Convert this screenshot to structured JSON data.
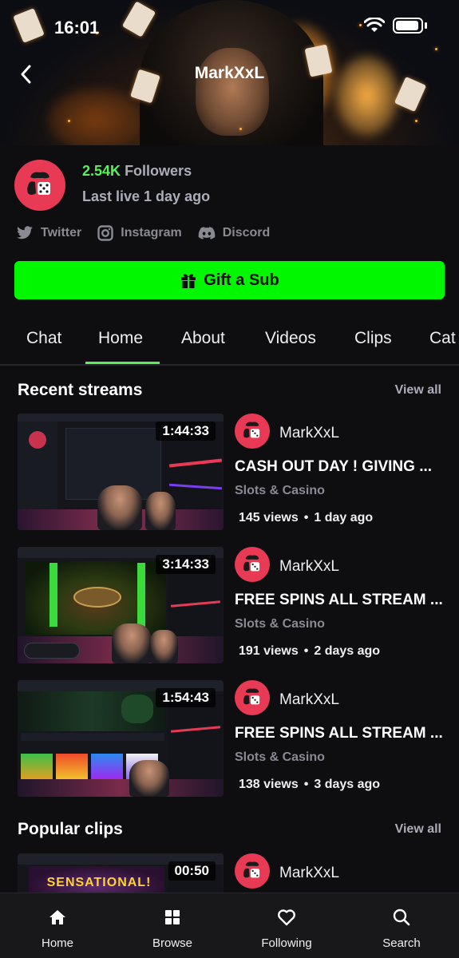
{
  "status_bar": {
    "time": "16:01"
  },
  "header": {
    "channel_name": "MarkXxL"
  },
  "profile": {
    "followers_count": "2.54K",
    "followers_label": "Followers",
    "last_live": "Last live 1 day ago"
  },
  "socials": [
    {
      "label": "Twitter",
      "icon": "twitter-icon"
    },
    {
      "label": "Instagram",
      "icon": "instagram-icon"
    },
    {
      "label": "Discord",
      "icon": "discord-icon"
    }
  ],
  "gift_button": {
    "label": "Gift a Sub"
  },
  "tabs": [
    {
      "label": "Chat"
    },
    {
      "label": "Home",
      "active": true
    },
    {
      "label": "About"
    },
    {
      "label": "Videos"
    },
    {
      "label": "Clips"
    },
    {
      "label": "Cat"
    }
  ],
  "recent_streams": {
    "title": "Recent streams",
    "view_all": "View all",
    "items": [
      {
        "duration": "1:44:33",
        "channel": "MarkXxL",
        "title": "CASH OUT DAY ! GIVING ...",
        "category": "Slots & Casino",
        "views": "145 views",
        "age": "1 day ago"
      },
      {
        "duration": "3:14:33",
        "channel": "MarkXxL",
        "title": "FREE SPINS ALL STREAM ...",
        "category": "Slots & Casino",
        "views": "191 views",
        "age": "2 days ago"
      },
      {
        "duration": "1:54:43",
        "channel": "MarkXxL",
        "title": "FREE SPINS ALL STREAM ...",
        "category": "Slots & Casino",
        "views": "138 views",
        "age": "3 days ago"
      }
    ]
  },
  "popular_clips": {
    "title": "Popular clips",
    "view_all": "View all",
    "items": [
      {
        "duration": "00:50",
        "channel": "MarkXxL",
        "thumb_text": "SENSATIONAL!"
      }
    ]
  },
  "bottom_nav": [
    {
      "label": "Home",
      "icon": "home-icon"
    },
    {
      "label": "Browse",
      "icon": "browse-icon"
    },
    {
      "label": "Following",
      "icon": "heart-icon"
    },
    {
      "label": "Search",
      "icon": "search-icon"
    }
  ],
  "colors": {
    "accent": "#5af059",
    "gift": "#00f700",
    "avatar": "#e93a55",
    "background": "#0e0e10"
  }
}
